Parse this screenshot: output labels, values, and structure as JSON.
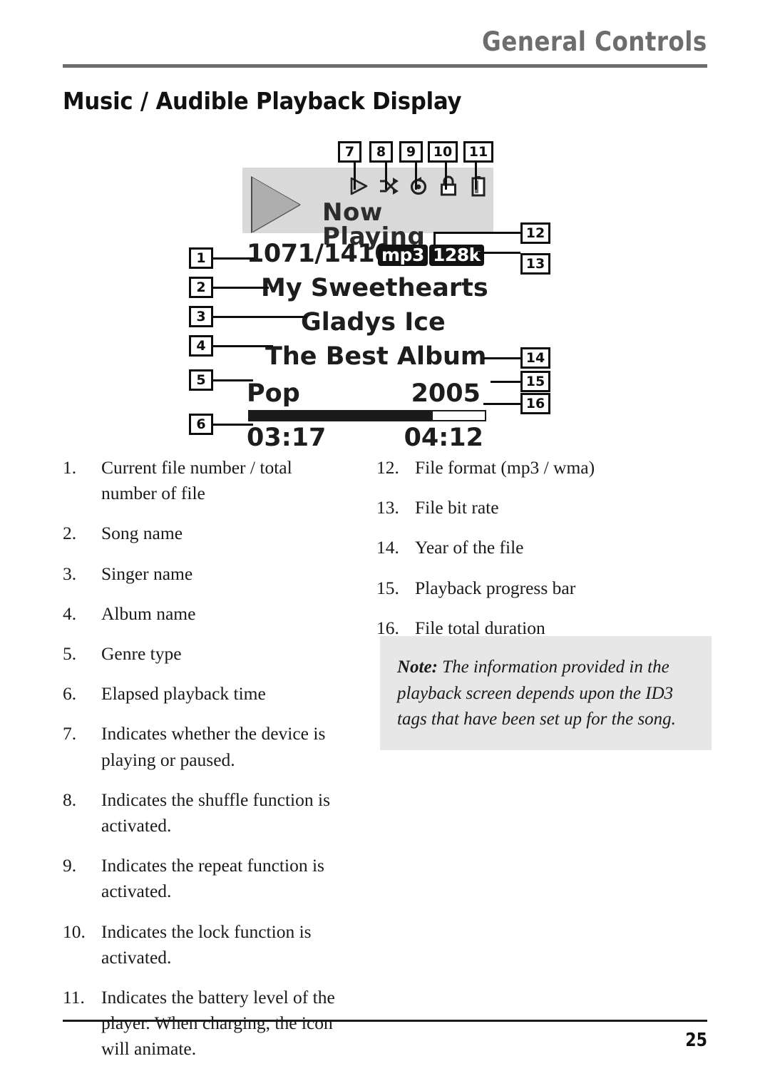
{
  "header": {
    "running_title": "General Controls"
  },
  "section": {
    "title": "Music / Audible Playback Display"
  },
  "device_display": {
    "now_playing_label": "Now Playing",
    "file_number": "1071/1410",
    "song_name": "My Sweethearts",
    "singer_name": "Gladys Ice",
    "album_name": "The Best Album",
    "genre": "Pop",
    "year": "2005",
    "elapsed_time": "03:17",
    "total_time": "04:12",
    "file_format": "mp3",
    "bit_rate": "128k",
    "progress_percent": 78,
    "status_icons": [
      {
        "id": "play",
        "name": "play-icon"
      },
      {
        "id": "shuffle",
        "name": "shuffle-icon"
      },
      {
        "id": "repeat",
        "name": "repeat-icon"
      },
      {
        "id": "lock",
        "name": "lock-icon"
      },
      {
        "id": "battery",
        "name": "battery-icon"
      }
    ],
    "callouts": [
      {
        "n": "1"
      },
      {
        "n": "2"
      },
      {
        "n": "3"
      },
      {
        "n": "4"
      },
      {
        "n": "5"
      },
      {
        "n": "6"
      },
      {
        "n": "7"
      },
      {
        "n": "8"
      },
      {
        "n": "9"
      },
      {
        "n": "10"
      },
      {
        "n": "11"
      },
      {
        "n": "12"
      },
      {
        "n": "13"
      },
      {
        "n": "14"
      },
      {
        "n": "15"
      },
      {
        "n": "16"
      }
    ]
  },
  "legend": {
    "left_column": [
      {
        "num": "1.",
        "text": "Current file number / total number of file"
      },
      {
        "num": "2.",
        "text": "Song name"
      },
      {
        "num": "3.",
        "text": "Singer name"
      },
      {
        "num": "4.",
        "text": "Album name"
      },
      {
        "num": "5.",
        "text": "Genre type"
      },
      {
        "num": "6.",
        "text": "Elapsed playback time"
      },
      {
        "num": "7.",
        "text": "Indicates whether the device is playing or paused."
      },
      {
        "num": "8.",
        "text": "Indicates the shuffle function is activated."
      },
      {
        "num": "9.",
        "text": "Indicates the repeat function is activated."
      },
      {
        "num": "10.",
        "text": "Indicates the lock function is activated."
      },
      {
        "num": "11.",
        "text": "Indicates the battery level of the player. When charging, the icon will animate."
      }
    ],
    "right_column": [
      {
        "num": "12.",
        "text": "File format (mp3 / wma)"
      },
      {
        "num": "13.",
        "text": "File bit rate"
      },
      {
        "num": "14.",
        "text": "Year of the file"
      },
      {
        "num": "15.",
        "text": "Playback progress bar"
      },
      {
        "num": "16.",
        "text": "File total duration"
      }
    ]
  },
  "note": {
    "label": "Note:",
    "text": " The information provided in the playback screen depends upon the ID3 tags that have been set up for the song."
  },
  "footer": {
    "page_number": "25"
  },
  "colors": {
    "running_head": "#6d6d6d",
    "lcd_header_bg": "#d9d9d9",
    "note_bg": "#e7e7e7",
    "ink": "#1a1a1a"
  }
}
